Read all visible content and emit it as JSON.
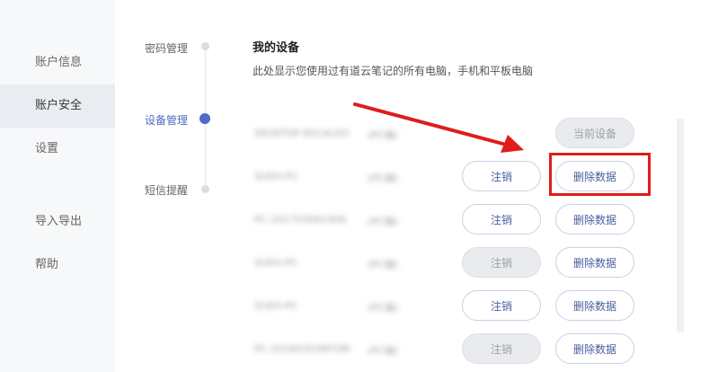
{
  "sidebar": {
    "items": [
      {
        "label": "账户信息"
      },
      {
        "label": "账户安全",
        "active": true
      },
      {
        "label": "设置"
      },
      {
        "label": "导入导出"
      },
      {
        "label": "帮助"
      }
    ]
  },
  "steps": [
    {
      "label": "密码管理"
    },
    {
      "label": "设备管理",
      "active": true
    },
    {
      "label": "短信提醒"
    }
  ],
  "section": {
    "title": "我的设备",
    "description": "此处显示您使用过有道云笔记的所有电脑，手机和平板电脑"
  },
  "devices": [
    {
      "name": "DESKTOP-8SCALEO",
      "type": "(PC端)",
      "current_label": "当前设备"
    },
    {
      "name": "SUEH-PC",
      "type": "(PC端)",
      "logout_label": "注销",
      "delete_label": "删除数据"
    },
    {
      "name": "PC-201703061406",
      "type": "(PC端)",
      "logout_label": "注销",
      "delete_label": "删除数据"
    },
    {
      "name": "SUEH-PC",
      "type": "(PC端)",
      "logout_label": "注销",
      "logout_disabled": true,
      "delete_label": "删除数据"
    },
    {
      "name": "SUEH-PC",
      "type": "(PC端)",
      "logout_label": "注销",
      "delete_label": "删除数据"
    },
    {
      "name": "PC-20160303RFOM",
      "type": "(PC端)",
      "logout_label": "注销",
      "logout_disabled": true,
      "delete_label": "删除数据"
    }
  ],
  "annotation": {
    "color": "#e01c1c"
  },
  "colors": {
    "accent": "#4f6bc5",
    "annotation": "#e01c1c"
  }
}
